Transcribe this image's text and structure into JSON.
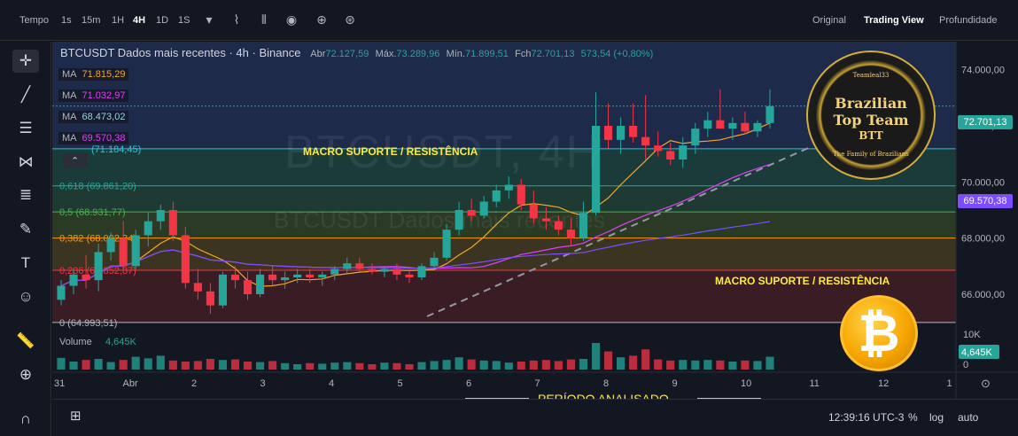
{
  "topbar": {
    "time_label": "Tempo",
    "intervals": [
      "1s",
      "15m",
      "1H",
      "4H",
      "1D",
      "1S"
    ],
    "active_interval": "4H",
    "views": [
      "Original",
      "Trading View",
      "Profundidade"
    ],
    "active_view": "Trading View"
  },
  "header": {
    "symbol": "BTCUSDT Dados mais recentes · 4h · Binance",
    "open_label": "Abr",
    "open": "72.127,59",
    "high_label": "Máx.",
    "high": "73.289,96",
    "low_label": "Mín.",
    "low": "71.899,51",
    "close_label": "Fch",
    "close": "72.701,13",
    "change": "573,54 (+0,80%)"
  },
  "moving_averages": [
    {
      "label": "MA",
      "value": "71.815,29",
      "color": "#f5a623"
    },
    {
      "label": "MA",
      "value": "71.032,97",
      "color": "#e040fb"
    },
    {
      "label": "MA",
      "value": "68.473,02",
      "color": "#9ad0e6"
    },
    {
      "label": "MA",
      "value": "69.570,38",
      "color": "#e040fb"
    }
  ],
  "fib_levels": [
    {
      "label": "(71.184,45)",
      "value": 71184.45,
      "color": "#26c6da"
    },
    {
      "label": "0,618 (69.861,20)",
      "value": 69861.2,
      "color": "#26a69a"
    },
    {
      "label": "0,5 (68.931,77)",
      "value": 68931.77,
      "color": "#4caf50"
    },
    {
      "label": "0,382 (68.002,34)",
      "value": 68002.34,
      "color": "#ff9800"
    },
    {
      "label": "0,236 (66.852,37)",
      "value": 66852.37,
      "color": "#f23645"
    },
    {
      "label": "0 (64.993,51)",
      "value": 64993.51,
      "color": "#b2b5be"
    }
  ],
  "annotations": {
    "macro_top": "MACRO SUPORTE  /  RESISTÊNCIA",
    "macro_bottom": "MACRO SUPORTE  /  RESISTÊNCIA",
    "period": "PERÍODO ANALISADO",
    "watermark": "BTCUSDT, 4H",
    "watermark_sub": "BTCUSDT Dados mais recentes"
  },
  "price_axis": {
    "ticks": [
      "74.000,00",
      "72.000,00",
      "70.000,00",
      "68.000,00",
      "66.000,00"
    ],
    "tick_values": [
      74000,
      72000,
      70000,
      68000,
      66000
    ],
    "current_price": "72.701,13",
    "current_value": 72701.13,
    "ma_price": "69.570,38",
    "ma_value": 69570.38
  },
  "volume": {
    "label": "Volume",
    "value": "4,645K",
    "axis_top": "10K",
    "axis_bottom": "0"
  },
  "time_axis": {
    "labels": [
      "31",
      "Abr",
      "2",
      "3",
      "4",
      "5",
      "6",
      "7",
      "8",
      "9",
      "10",
      "11",
      "12",
      "1"
    ]
  },
  "bottombar": {
    "clock": "12:39:16 UTC-3",
    "percent": "%",
    "log": "log",
    "auto": "auto"
  },
  "logo": {
    "line1": "Brazilian",
    "line2": "Top Team",
    "line3": "BTT",
    "ring_top": "Teamleal33",
    "ring_bottom": "The Family of Brazilians"
  },
  "coin_symbol": "₿",
  "colors": {
    "up": "#26a69a",
    "down": "#f23645",
    "background": "#131722",
    "band_top": "#1e2a4a",
    "band_mid": "#2a3a25",
    "band_bottom": "#3a1c24"
  },
  "chart_data": {
    "type": "candlestick",
    "title": "BTCUSDT Dados mais recentes · 4h · Binance",
    "ylim": [
      64800,
      75000
    ],
    "candles": [
      [
        65800,
        66500,
        65600,
        66300
      ],
      [
        66300,
        66900,
        66000,
        66700
      ],
      [
        66700,
        67400,
        66200,
        66500
      ],
      [
        66500,
        67800,
        66100,
        67500
      ],
      [
        67500,
        68200,
        67200,
        68000
      ],
      [
        68000,
        68600,
        66800,
        67000
      ],
      [
        67000,
        68300,
        66900,
        68100
      ],
      [
        68100,
        68900,
        67700,
        68600
      ],
      [
        68600,
        69200,
        68300,
        69000
      ],
      [
        69000,
        69300,
        67900,
        68100
      ],
      [
        68100,
        68400,
        66200,
        66400
      ],
      [
        66400,
        66900,
        65800,
        66100
      ],
      [
        66100,
        66400,
        65300,
        65600
      ],
      [
        65600,
        66800,
        65500,
        66700
      ],
      [
        66700,
        67000,
        66200,
        66500
      ],
      [
        66500,
        66800,
        65800,
        66000
      ],
      [
        66000,
        66900,
        65900,
        66700
      ],
      [
        66700,
        67000,
        66300,
        66500
      ],
      [
        66500,
        66800,
        66200,
        66600
      ],
      [
        66600,
        66900,
        66400,
        66700
      ],
      [
        66700,
        66900,
        66400,
        66600
      ],
      [
        66600,
        66800,
        66300,
        66700
      ],
      [
        66700,
        67000,
        66500,
        66900
      ],
      [
        66900,
        67300,
        66700,
        67100
      ],
      [
        67100,
        67300,
        66800,
        66900
      ],
      [
        66900,
        67100,
        66700,
        66800
      ],
      [
        66800,
        67000,
        66600,
        66900
      ],
      [
        66900,
        67100,
        66500,
        66700
      ],
      [
        66700,
        66900,
        66400,
        66600
      ],
      [
        66600,
        67100,
        66500,
        67000
      ],
      [
        67000,
        67500,
        66900,
        67300
      ],
      [
        67300,
        68500,
        67200,
        68300
      ],
      [
        68300,
        69300,
        68100,
        69000
      ],
      [
        69000,
        69400,
        68600,
        68800
      ],
      [
        68800,
        69500,
        68700,
        69300
      ],
      [
        69300,
        69900,
        69100,
        69700
      ],
      [
        69700,
        70200,
        69400,
        69900
      ],
      [
        69900,
        70100,
        69000,
        69200
      ],
      [
        69200,
        69700,
        68500,
        68700
      ],
      [
        68700,
        69100,
        68300,
        68600
      ],
      [
        68600,
        68800,
        68100,
        68300
      ],
      [
        68300,
        68700,
        67700,
        68000
      ],
      [
        68000,
        69300,
        67900,
        68900
      ],
      [
        68900,
        73200,
        68800,
        72000
      ],
      [
        72000,
        72800,
        71200,
        71500
      ],
      [
        71500,
        72300,
        71000,
        72000
      ],
      [
        72000,
        72800,
        71400,
        71600
      ],
      [
        71600,
        73100,
        70800,
        71300
      ],
      [
        71300,
        71800,
        70900,
        71100
      ],
      [
        71100,
        71400,
        70600,
        70800
      ],
      [
        70800,
        71600,
        70500,
        71300
      ],
      [
        71300,
        72100,
        71000,
        71900
      ],
      [
        71900,
        72500,
        71600,
        72200
      ],
      [
        72200,
        73300,
        72000,
        71900
      ],
      [
        71900,
        72300,
        71500,
        72100
      ],
      [
        72100,
        72500,
        71700,
        71800
      ],
      [
        71800,
        72200,
        71600,
        72100
      ],
      [
        72100,
        73300,
        71900,
        72701
      ]
    ],
    "volumes": [
      2.2,
      1.5,
      1.8,
      2.0,
      1.4,
      1.8,
      2.4,
      2.1,
      2.6,
      1.7,
      1.5,
      1.6,
      2.0,
      1.8,
      1.9,
      1.5,
      1.4,
      1.6,
      1.2,
      1.0,
      1.2,
      1.1,
      1.3,
      1.4,
      1.2,
      1.0,
      1.3,
      1.2,
      1.0,
      1.4,
      1.6,
      1.8,
      2.3,
      1.9,
      1.7,
      1.6,
      1.3,
      1.5,
      1.7,
      1.8,
      1.6,
      1.9,
      2.0,
      5.0,
      3.4,
      2.3,
      2.6,
      3.8,
      1.9,
      1.7,
      1.8,
      1.7,
      1.8,
      1.7,
      1.5,
      1.7,
      1.6,
      2.4
    ]
  }
}
